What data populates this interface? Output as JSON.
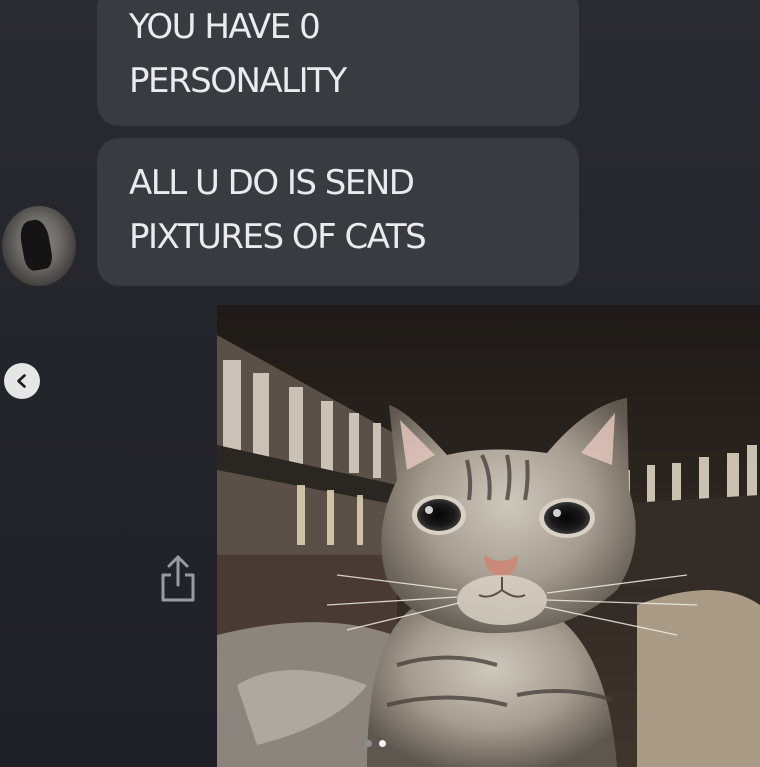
{
  "messages": [
    {
      "lines": [
        "YOU HAVE 0",
        "PERSONALITY"
      ]
    },
    {
      "lines": [
        "ALL U DO IS SEND",
        "PIXTURES OF CATS"
      ]
    }
  ],
  "carousel": {
    "total": 2,
    "active_index": 1
  },
  "icons": {
    "carousel_prev": "chevron-left-icon",
    "share": "share-icon"
  },
  "colors": {
    "background": "#26262d",
    "bubble": "#3a3a41",
    "bubble_text": "#ebebee"
  }
}
